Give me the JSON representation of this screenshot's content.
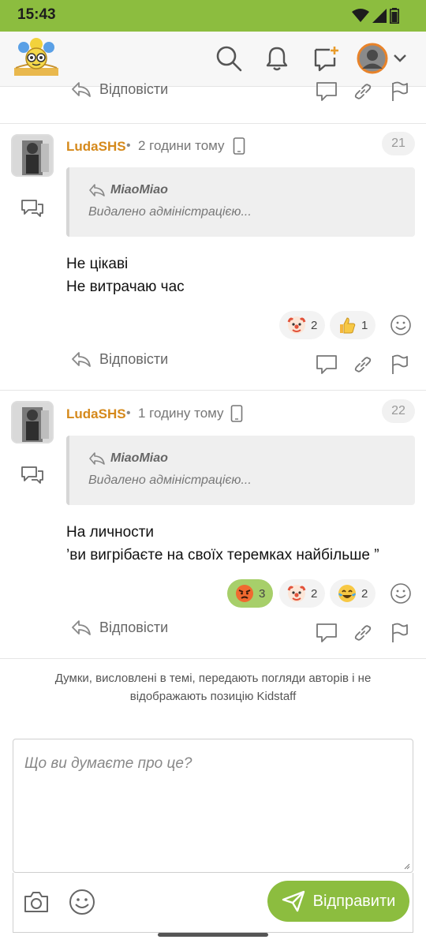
{
  "status_bar": {
    "time": "15:43"
  },
  "header": {
    "logo_icon": "kidstaff-logo",
    "search_icon": "search-icon",
    "bell_icon": "bell-icon",
    "new_post_icon": "new-post-icon",
    "avatar_icon": "avatar-icon"
  },
  "actions": {
    "reply_label": "Відповісти"
  },
  "comments": [
    {
      "author": "LudaSHS",
      "time": "2 години тому",
      "number": "21",
      "quote_author": "MiaoMiao",
      "quote_text": "Видалено адміністрацією...",
      "lines": [
        "Не цікаві",
        "Не витрачаю час"
      ],
      "reactions": [
        {
          "emoji": "clown",
          "count": "2",
          "active": false
        },
        {
          "emoji": "thumbs-up",
          "count": "1",
          "active": false
        }
      ]
    },
    {
      "author": "LudaSHS",
      "time": "1 годину тому",
      "number": "22",
      "quote_author": "MiaoMiao",
      "quote_text": "Видалено адміністрацією...",
      "lines": [
        "На личности",
        "’ви вигрібаєте на своїх теремках найбільше ”"
      ],
      "reactions": [
        {
          "emoji": "angry",
          "count": "3",
          "active": true
        },
        {
          "emoji": "clown",
          "count": "2",
          "active": false
        },
        {
          "emoji": "joy",
          "count": "2",
          "active": false
        }
      ]
    }
  ],
  "disclaimer": "Думки, висловлені в темі, передають погляди авторів і не відображають позицію Kidstaff",
  "composer": {
    "placeholder": "Що ви думаєте про це?",
    "send_label": "Відправити"
  },
  "colors": {
    "brand_green": "#8cbd3f",
    "author_orange": "#d5891b",
    "active_reaction": "#a7cf6a"
  }
}
